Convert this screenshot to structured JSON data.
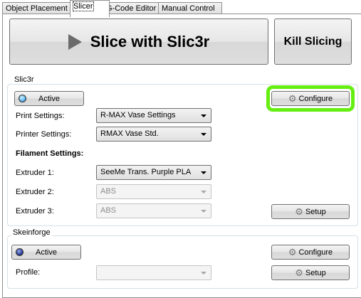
{
  "tabs": [
    "Object Placement",
    "Slicer",
    "G-Code Editor",
    "Manual Control"
  ],
  "slice_button": "Slice with Slic3r",
  "kill_button": "Kill Slicing",
  "slic3r": {
    "title": "Slic3r",
    "active_label": "Active",
    "configure_label": "Configure",
    "print_settings_label": "Print Settings:",
    "print_settings_value": "R-MAX Vase Settings",
    "printer_settings_label": "Printer Settings:",
    "printer_settings_value": "RMAX Vase Std.",
    "filament_heading": "Filament Settings:",
    "extruders": [
      {
        "label": "Extruder 1:",
        "value": "SeeMe Trans. Purple PLA"
      },
      {
        "label": "Extruder 2:",
        "value": "ABS"
      },
      {
        "label": "Extruder 3:",
        "value": "ABS"
      }
    ],
    "setup_label": "Setup"
  },
  "skeinforge": {
    "title": "Skeinforge",
    "active_label": "Active",
    "configure_label": "Configure",
    "profile_label": "Profile:",
    "profile_value": "",
    "setup_label": "Setup"
  },
  "colors": {
    "highlight": "#66ee11",
    "led_active": "#5ab4f0",
    "led_inactive": "#2a3f9a"
  }
}
